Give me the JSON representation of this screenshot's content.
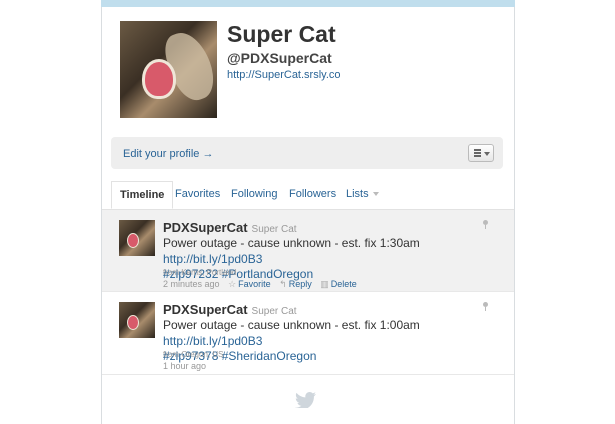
{
  "profile": {
    "name": "Super Cat",
    "handle": "@PDXSuperCat",
    "website": "http://SuperCat.srsly.co",
    "edit_profile": "Edit your profile →"
  },
  "tabs": [
    "Timeline",
    "Favorites",
    "Following",
    "Followers",
    "Lists"
  ],
  "tweets": [
    {
      "screen_name": "PDXSuperCat",
      "full_name": "Super Cat",
      "text": "Power outage - cause unknown - est. fix 1:30am ",
      "link": "http://bit.ly/1pd0B3",
      "hashtags": "#zip97232 #PortlandOregon",
      "location": "from Kerns, Portland",
      "time": "2 minutes ago",
      "actions": {
        "favorite": "Favorite",
        "reply": "Reply",
        "delete": "Delete"
      }
    },
    {
      "screen_name": "PDXSuperCat",
      "full_name": "Super Cat",
      "text": "Power outage - cause unknown - est. fix 1:00am ",
      "link": "http://bit.ly/1pd0B3",
      "hashtags": "#zip97378 #SheridanOregon",
      "location": "from Oregon, US",
      "time": "1 hour ago"
    }
  ],
  "icons": {
    "favorite": "star-icon",
    "reply": "reply-arrow-icon",
    "delete": "trash-icon",
    "location": "map-pin-icon",
    "footer": "twitter-bird-icon",
    "list": "list-menu-icon"
  },
  "colors": {
    "background": "#c0deed",
    "link": "#2a6496",
    "highlight_row": "#f1f1f1"
  }
}
